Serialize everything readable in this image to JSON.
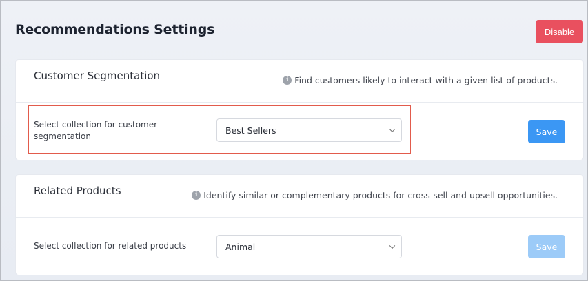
{
  "header": {
    "title": "Recommendations Settings",
    "disable_label": "Disable"
  },
  "sections": [
    {
      "title": "Customer Segmentation",
      "description": "Find customers likely to interact with a given list of products.",
      "row_label": "Select collection for customer segmentation",
      "selected_value": "Best Sellers",
      "save_label": "Save",
      "save_enabled": true
    },
    {
      "title": "Related Products",
      "description": "Identify similar or complementary products for cross-sell and upsell opportunities.",
      "row_label": "Select collection for related products",
      "selected_value": "Animal",
      "save_label": "Save",
      "save_enabled": false
    }
  ],
  "colors": {
    "disable_button": "#e9505f",
    "save_active": "#3b97f4",
    "save_disabled": "#9ccbf8",
    "highlight_border": "#e25b4c"
  },
  "icons": {
    "info": "info-icon",
    "dropdown": "chevron-down-icon"
  }
}
